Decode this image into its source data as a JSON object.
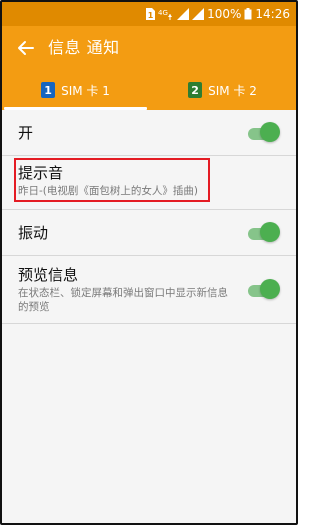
{
  "status_bar": {
    "sim_badge": "1",
    "network_type": "4G",
    "battery_text": "100%",
    "time": "14:26",
    "icons": [
      "sim-1-icon",
      "4g-icon",
      "signal-icon",
      "signal-icon",
      "battery-icon"
    ]
  },
  "app_bar": {
    "title": "信息 通知",
    "back_icon": "arrow-left-icon"
  },
  "tabs": [
    {
      "label": "SIM 卡 1",
      "badge": "1",
      "badge_color": "#1565c0",
      "selected": true
    },
    {
      "label": "SIM 卡 2",
      "badge": "2",
      "badge_color": "#2e7d32",
      "selected": false
    }
  ],
  "settings": {
    "on_row": {
      "label": "开",
      "toggle_on": true
    },
    "sound_row": {
      "label": "提示音",
      "summary": "昨日-(电视剧《面包树上的女人》插曲)"
    },
    "vibration_row": {
      "label": "振动",
      "toggle_on": true
    },
    "preview_row": {
      "label": "预览信息",
      "summary": "在状态栏、锁定屏幕和弹出窗口中显示新信息的预览",
      "toggle_on": true
    }
  },
  "colors": {
    "status_bar": "#e08a00",
    "app_bar": "#f39c12",
    "toggle_thumb": "#4caf50",
    "toggle_track": "#86c48a",
    "highlight": "#e41b23",
    "sim1_badge": "#1565c0",
    "sim2_badge": "#2e7d32"
  }
}
